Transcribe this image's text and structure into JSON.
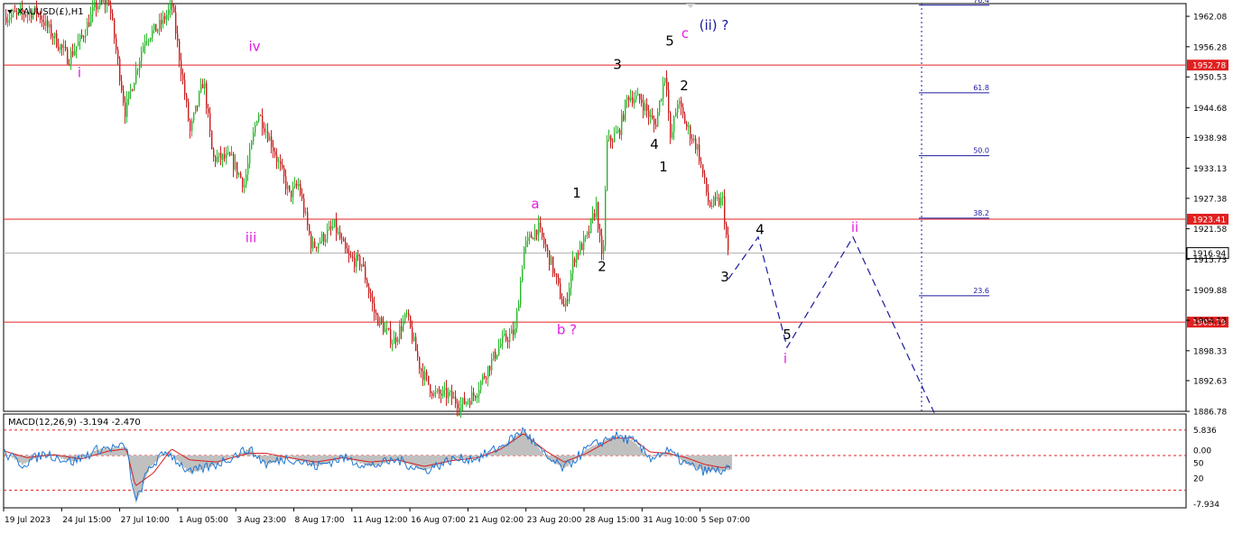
{
  "symbol_title": "XAUUSD(£),H1",
  "macd_title": "MACD(12,26,9) -3.194 -2.470",
  "colors": {
    "bull": "#2bb52b",
    "bear": "#c81e1e",
    "level": "#e02020",
    "fib": "#1a1aa0",
    "wave_pink": "#e020e0",
    "wave_blue": "#1a1aa0",
    "macd_hist": "#c0c0c0",
    "macd_line": "#1f77d4",
    "signal_line": "#d62020"
  },
  "chart_data": [
    {
      "type": "candlestick",
      "symbol": "XAUUSD(£)",
      "timeframe": "H1",
      "ylim": [
        1886.78,
        1964.5
      ],
      "y_ticks": [
        "1962.08",
        "1956.28",
        "1950.53",
        "1944.68",
        "1938.98",
        "1933.13",
        "1927.38",
        "1921.58",
        "1915.73",
        "1909.88",
        "1904.13",
        "1898.33",
        "1892.63",
        "1886.78"
      ],
      "x_ticks": [
        "19 Jul 2023",
        "24 Jul 15:00",
        "27 Jul 10:00",
        "1 Aug 05:00",
        "3 Aug 23:00",
        "8 Aug 17:00",
        "11 Aug 12:00",
        "16 Aug 07:00",
        "21 Aug 02:00",
        "23 Aug 20:00",
        "28 Aug 15:00",
        "31 Aug 10:00",
        "5 Sep 07:00"
      ],
      "price_path": [
        [
          0,
          1962
        ],
        [
          40,
          1963
        ],
        [
          75,
          1954
        ],
        [
          90,
          1958
        ],
        [
          105,
          1964
        ],
        [
          120,
          1965
        ],
        [
          138,
          1944
        ],
        [
          160,
          1958
        ],
        [
          175,
          1960
        ],
        [
          190,
          1964
        ],
        [
          200,
          1952
        ],
        [
          210,
          1940
        ],
        [
          225,
          1950
        ],
        [
          235,
          1935
        ],
        [
          255,
          1935
        ],
        [
          270,
          1930
        ],
        [
          285,
          1944
        ],
        [
          300,
          1938
        ],
        [
          320,
          1928
        ],
        [
          330,
          1930
        ],
        [
          345,
          1918
        ],
        [
          370,
          1922
        ],
        [
          385,
          1916
        ],
        [
          400,
          1915
        ],
        [
          415,
          1905
        ],
        [
          435,
          1900
        ],
        [
          450,
          1905
        ],
        [
          465,
          1895
        ],
        [
          480,
          1890
        ],
        [
          495,
          1890
        ],
        [
          510,
          1888
        ],
        [
          525,
          1890
        ],
        [
          540,
          1895
        ],
        [
          555,
          1900
        ],
        [
          570,
          1902
        ],
        [
          580,
          1918
        ],
        [
          595,
          1922
        ],
        [
          610,
          1915
        ],
        [
          625,
          1906
        ],
        [
          635,
          1916
        ],
        [
          650,
          1920
        ],
        [
          660,
          1926
        ],
        [
          667,
          1914
        ],
        [
          672,
          1938
        ],
        [
          685,
          1940
        ],
        [
          695,
          1947
        ],
        [
          710,
          1946
        ],
        [
          725,
          1941
        ],
        [
          737,
          1952
        ],
        [
          742,
          1938
        ],
        [
          750,
          1946
        ],
        [
          760,
          1941
        ],
        [
          772,
          1937
        ],
        [
          785,
          1926
        ],
        [
          800,
          1927
        ],
        [
          807,
          1915
        ]
      ],
      "current_price": "1916.94",
      "levels": [
        {
          "price": 1952.78,
          "label": "1952.78"
        },
        {
          "price": 1923.41,
          "label": "1923.41"
        },
        {
          "price": 1903.79,
          "label": "1903.79"
        }
      ],
      "fibonacci": [
        {
          "price": 1964.2,
          "label": "76.4"
        },
        {
          "price": 1947.5,
          "label": "61.8"
        },
        {
          "price": 1935.5,
          "label": "50.0"
        },
        {
          "price": 1923.6,
          "label": "38.2"
        },
        {
          "price": 1908.8,
          "label": "23.6"
        }
      ],
      "projection_path": [
        [
          807,
          1912
        ],
        [
          840,
          1920
        ],
        [
          872,
          1899
        ],
        [
          945,
          1920
        ],
        [
          1035,
          1886.5
        ]
      ],
      "wave_labels": [
        {
          "text": "i",
          "color": "pink",
          "x": 88,
          "price": 1950.5
        },
        {
          "text": "iv",
          "color": "pink",
          "x": 282,
          "price": 1955.5
        },
        {
          "text": "iii",
          "color": "pink",
          "x": 278,
          "price": 1919
        },
        {
          "text": "a",
          "color": "pink",
          "x": 593,
          "price": 1925.5
        },
        {
          "text": "b ?",
          "color": "pink",
          "x": 628,
          "price": 1901.5
        },
        {
          "text": "1",
          "color": "black",
          "x": 639,
          "price": 1927.5
        },
        {
          "text": "2",
          "color": "black",
          "x": 667,
          "price": 1913.5
        },
        {
          "text": "3",
          "color": "black",
          "x": 684,
          "price": 1952
        },
        {
          "text": "4",
          "color": "black",
          "x": 725,
          "price": 1936.8
        },
        {
          "text": "1",
          "color": "black",
          "x": 735,
          "price": 1932.5
        },
        {
          "text": "5",
          "color": "black",
          "x": 742,
          "price": 1956.5
        },
        {
          "text": "c",
          "color": "pink",
          "x": 759,
          "price": 1958
        },
        {
          "text": "(ii) ?",
          "color": "blue",
          "x": 791,
          "price": 1959.5
        },
        {
          "text": "2",
          "color": "black",
          "x": 758,
          "price": 1948
        },
        {
          "text": "3",
          "color": "black",
          "x": 803,
          "price": 1911.5
        },
        {
          "text": "4",
          "color": "black",
          "x": 842,
          "price": 1920.6
        },
        {
          "text": "ii",
          "color": "pink",
          "x": 947,
          "price": 1921
        },
        {
          "text": "5",
          "color": "black",
          "x": 872,
          "price": 1900.5
        },
        {
          "text": "i",
          "color": "pink",
          "x": 870,
          "price": 1896
        }
      ],
      "vertical_marker_x": 1021
    },
    {
      "type": "macd",
      "params": "12,26,9",
      "values": {
        "macd": -3.194,
        "signal": -2.47
      },
      "ylim": [
        -12,
        9.5
      ],
      "y_ticks": [
        "5.836",
        "0.00",
        "-7.934"
      ],
      "levels_right": [
        "50",
        "20"
      ],
      "macd_path": [
        [
          5,
          0.5
        ],
        [
          25,
          -2
        ],
        [
          50,
          0.5
        ],
        [
          80,
          -1.5
        ],
        [
          110,
          1.5
        ],
        [
          140,
          2
        ],
        [
          150,
          -11
        ],
        [
          165,
          -3
        ],
        [
          185,
          1
        ],
        [
          210,
          -4
        ],
        [
          240,
          -2
        ],
        [
          275,
          1.5
        ],
        [
          295,
          -2
        ],
        [
          320,
          -0.5
        ],
        [
          350,
          -2.5
        ],
        [
          380,
          -0.5
        ],
        [
          410,
          -2.5
        ],
        [
          440,
          -1
        ],
        [
          470,
          -3.5
        ],
        [
          500,
          -1
        ],
        [
          530,
          -0.5
        ],
        [
          555,
          2
        ],
        [
          580,
          5.8
        ],
        [
          605,
          -0.5
        ],
        [
          625,
          -3
        ],
        [
          650,
          1.5
        ],
        [
          680,
          4.5
        ],
        [
          700,
          3.5
        ],
        [
          720,
          -0.5
        ],
        [
          740,
          1
        ],
        [
          760,
          -2
        ],
        [
          780,
          -3.5
        ],
        [
          800,
          -3.5
        ],
        [
          810,
          -3.2
        ]
      ],
      "signal_path": [
        [
          5,
          1
        ],
        [
          30,
          -0.5
        ],
        [
          60,
          0.2
        ],
        [
          90,
          -0.8
        ],
        [
          120,
          1
        ],
        [
          140,
          1.5
        ],
        [
          150,
          -7
        ],
        [
          170,
          -4
        ],
        [
          190,
          1.5
        ],
        [
          210,
          -1
        ],
        [
          240,
          -1.5
        ],
        [
          275,
          0.5
        ],
        [
          295,
          0.5
        ],
        [
          320,
          -0.5
        ],
        [
          350,
          -1.5
        ],
        [
          380,
          -0.5
        ],
        [
          410,
          -1.5
        ],
        [
          440,
          -1
        ],
        [
          470,
          -2.5
        ],
        [
          500,
          -1.2
        ],
        [
          530,
          -0.5
        ],
        [
          555,
          1.5
        ],
        [
          580,
          5
        ],
        [
          605,
          1
        ],
        [
          625,
          -1.5
        ],
        [
          650,
          0.5
        ],
        [
          680,
          4
        ],
        [
          700,
          4
        ],
        [
          720,
          0.8
        ],
        [
          740,
          0.5
        ],
        [
          760,
          -0.5
        ],
        [
          780,
          -2
        ],
        [
          800,
          -2.8
        ],
        [
          810,
          -2.5
        ]
      ]
    }
  ]
}
